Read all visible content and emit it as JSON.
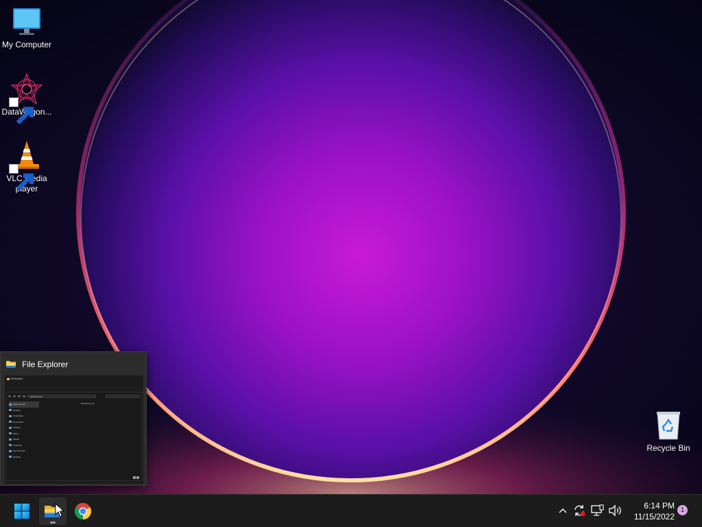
{
  "desktop": {
    "icons": [
      {
        "label": "My Computer",
        "icon": "monitor-icon"
      },
      {
        "label": "DataWagon...",
        "icon": "datawagon-app-icon",
        "shortcut": true
      },
      {
        "label": "VLC media player",
        "icon": "vlc-cone-icon",
        "shortcut": true
      },
      {
        "label": "Recycle Bin",
        "icon": "recycle-bin-icon"
      }
    ]
  },
  "preview": {
    "title": "File Explorer",
    "mini": {
      "tab_label": "Workspace",
      "address": "Quick access",
      "tree": [
        "Quick access",
        "Desktop",
        "Downloads",
        "Documents",
        "Pictures",
        "Music",
        "Videos",
        "OneDrive",
        "My Computer",
        "Network"
      ],
      "content_label": "Workspace (1)"
    }
  },
  "taskbar": {
    "apps": [
      {
        "name": "start",
        "icon": "windows-logo-icon"
      },
      {
        "name": "file-explorer",
        "icon": "folder-icon",
        "active": true
      },
      {
        "name": "chrome",
        "icon": "chrome-icon"
      }
    ],
    "tray": {
      "icons": [
        "chevron-up-icon",
        "sync-icon",
        "network-icon",
        "volume-icon"
      ]
    },
    "time": "6:14 PM",
    "date": "11/15/2022",
    "notifications": "1"
  },
  "colors": {
    "taskbar_bg": "#1c1c1c",
    "wallpaper_glow": "#b014c8",
    "wallpaper_rim": "#ff5a7a"
  }
}
